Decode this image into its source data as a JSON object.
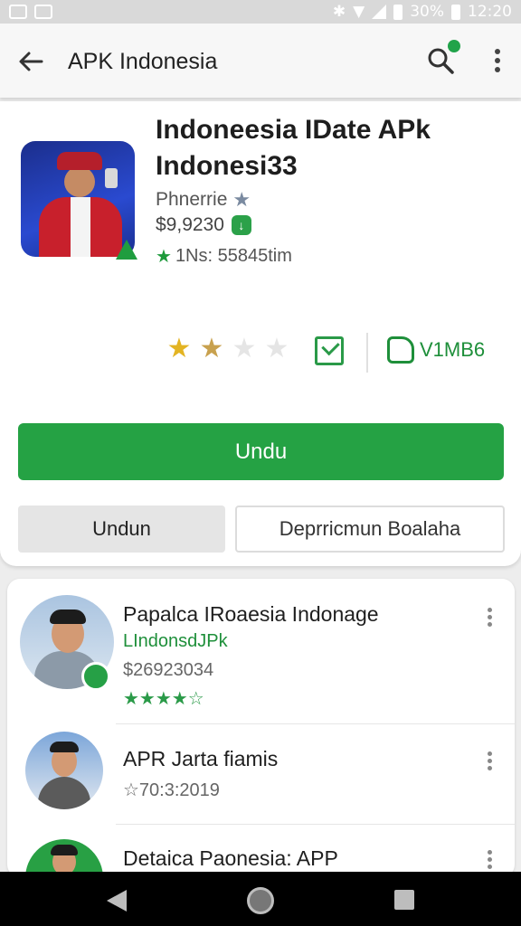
{
  "status_bar": {
    "battery": "30%",
    "time": "12:20"
  },
  "app_bar": {
    "title": "APK Indonesia",
    "icons": [
      "back-arrow-icon",
      "search-icon",
      "more-vert-icon"
    ]
  },
  "app_detail": {
    "name_line1": "Indoneesia IDate APk",
    "name_line2": "Indonesi33",
    "developer": "Phnerrie",
    "price": "$9,9230",
    "installs": "1Ns: 55845tim",
    "rating_stars": [
      {
        "type": "full"
      },
      {
        "type": "full"
      },
      {
        "type": "empty"
      },
      {
        "type": "empty"
      }
    ],
    "share_label": "V1MB6",
    "install_button": "Undu",
    "secondary_button": "Undun",
    "outline_button": "Deprricmun Boalaha",
    "accent_color": "#25a244"
  },
  "list": {
    "items": [
      {
        "title": "Papalca IRoaesia Indonage",
        "subtitle": "LIndonsdJPk",
        "meta": "$26923034",
        "stars": "★★★★☆"
      },
      {
        "title": "APR Jarta fiamis",
        "meta": "☆70:3:2019"
      },
      {
        "title": "Detaica Paonesia: APP"
      }
    ]
  }
}
